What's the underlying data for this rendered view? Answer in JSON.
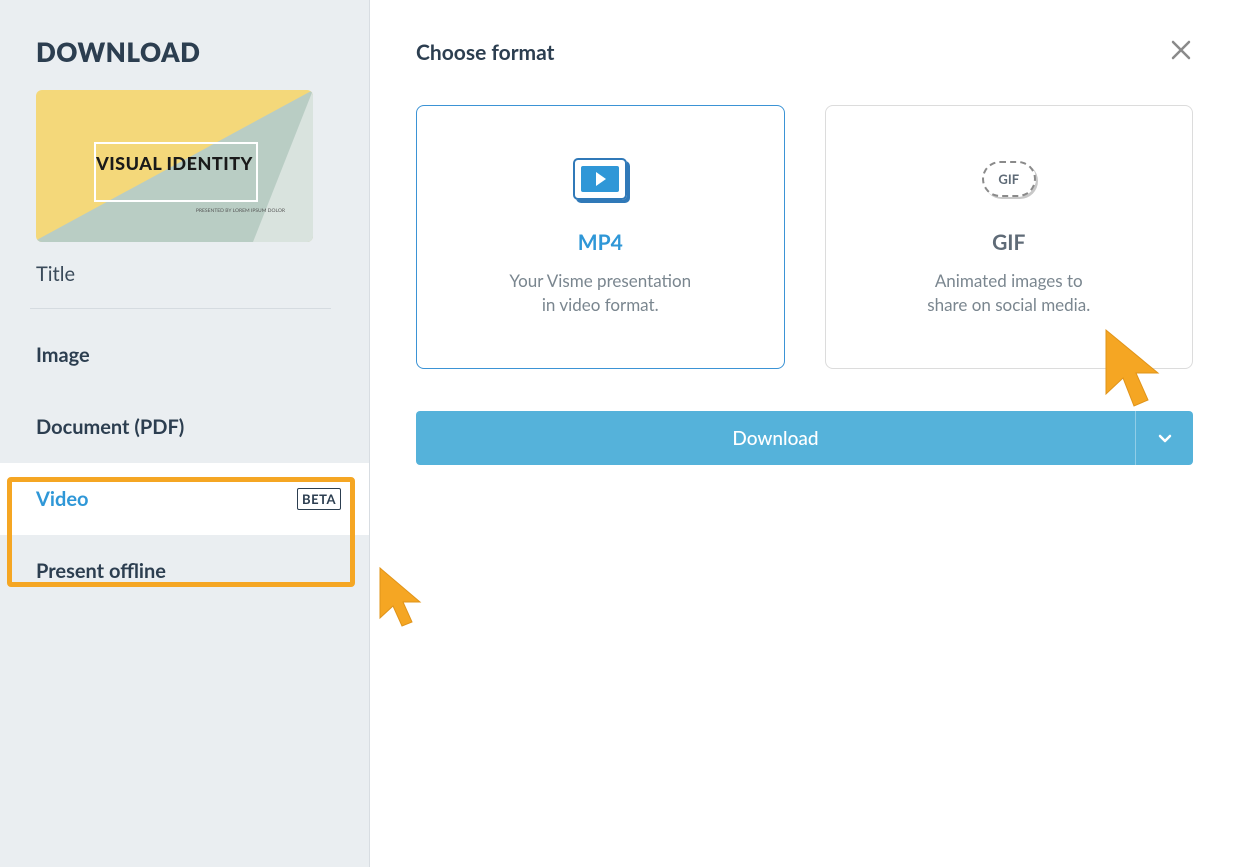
{
  "sidebar": {
    "title": "DOWNLOAD",
    "thumbnail_text": "VISUAL IDENTITY",
    "thumbnail_subtext": "PRESENTED BY\nLOREM IPSUM DOLOR",
    "thumbnail_label": "Title",
    "nav": [
      {
        "label": "Image",
        "active": false,
        "badge": null
      },
      {
        "label": "Document (PDF)",
        "active": false,
        "badge": null
      },
      {
        "label": "Video",
        "active": true,
        "badge": "BETA"
      },
      {
        "label": "Present offline",
        "active": false,
        "badge": null
      }
    ]
  },
  "main": {
    "heading": "Choose format",
    "cards": [
      {
        "title": "MP4",
        "desc_line1": "Your Visme presentation",
        "desc_line2": "in video format.",
        "selected": true
      },
      {
        "title": "GIF",
        "icon_label": "GIF",
        "desc_line1": "Animated images to",
        "desc_line2": "share on social media.",
        "selected": false
      }
    ],
    "download_label": "Download"
  }
}
